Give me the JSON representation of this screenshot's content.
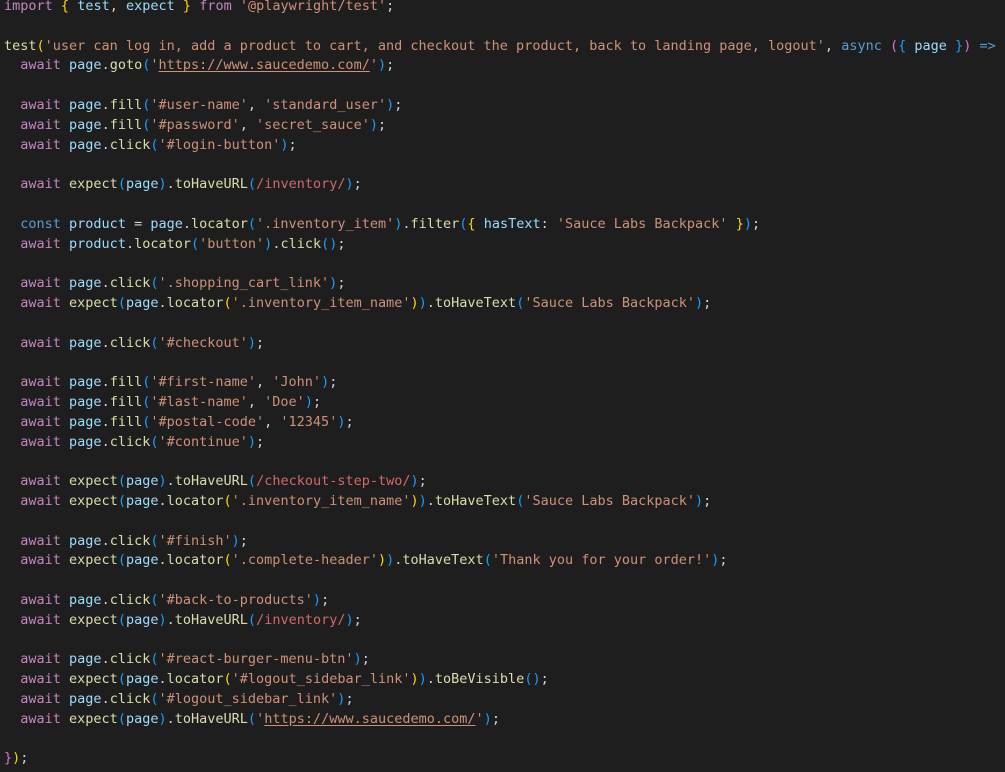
{
  "editor": {
    "lines": [
      [
        [
          "k",
          "import"
        ],
        [
          "p",
          " "
        ],
        [
          "b1",
          "{"
        ],
        [
          "p",
          " "
        ],
        [
          "v",
          "test"
        ],
        [
          "p",
          ", "
        ],
        [
          "v",
          "expect"
        ],
        [
          "p",
          " "
        ],
        [
          "b1",
          "}"
        ],
        [
          "p",
          " "
        ],
        [
          "k",
          "from"
        ],
        [
          "p",
          " "
        ],
        [
          "s",
          "'@playwright/test'"
        ],
        [
          "p",
          ";"
        ]
      ],
      [],
      [
        [
          "f",
          "test"
        ],
        [
          "b1",
          "("
        ],
        [
          "s",
          "'user can log in, add a product to cart, and checkout the product, back to landing page, logout'"
        ],
        [
          "p",
          ", "
        ],
        [
          "d",
          "async"
        ],
        [
          "p",
          " "
        ],
        [
          "b2",
          "("
        ],
        [
          "b3",
          "{"
        ],
        [
          "p",
          " "
        ],
        [
          "v",
          "page"
        ],
        [
          "p",
          " "
        ],
        [
          "b3",
          "}"
        ],
        [
          "b2",
          ")"
        ],
        [
          "p",
          " "
        ],
        [
          "d",
          "=>"
        ],
        [
          "p",
          " "
        ],
        [
          "b2",
          "{"
        ]
      ],
      [
        [
          "p",
          "  "
        ],
        [
          "k",
          "await"
        ],
        [
          "p",
          " "
        ],
        [
          "v",
          "page"
        ],
        [
          "p",
          "."
        ],
        [
          "f",
          "goto"
        ],
        [
          "b3",
          "("
        ],
        [
          "s",
          "'"
        ],
        [
          "us",
          "https://www.saucedemo.com/"
        ],
        [
          "s",
          "'"
        ],
        [
          "b3",
          ")"
        ],
        [
          "p",
          ";"
        ]
      ],
      [],
      [
        [
          "p",
          "  "
        ],
        [
          "k",
          "await"
        ],
        [
          "p",
          " "
        ],
        [
          "v",
          "page"
        ],
        [
          "p",
          "."
        ],
        [
          "f",
          "fill"
        ],
        [
          "b3",
          "("
        ],
        [
          "s",
          "'#user-name'"
        ],
        [
          "p",
          ", "
        ],
        [
          "s",
          "'standard_user'"
        ],
        [
          "b3",
          ")"
        ],
        [
          "p",
          ";"
        ]
      ],
      [
        [
          "p",
          "  "
        ],
        [
          "k",
          "await"
        ],
        [
          "p",
          " "
        ],
        [
          "v",
          "page"
        ],
        [
          "p",
          "."
        ],
        [
          "f",
          "fill"
        ],
        [
          "b3",
          "("
        ],
        [
          "s",
          "'#password'"
        ],
        [
          "p",
          ", "
        ],
        [
          "s",
          "'secret_sauce'"
        ],
        [
          "b3",
          ")"
        ],
        [
          "p",
          ";"
        ]
      ],
      [
        [
          "p",
          "  "
        ],
        [
          "k",
          "await"
        ],
        [
          "p",
          " "
        ],
        [
          "v",
          "page"
        ],
        [
          "p",
          "."
        ],
        [
          "f",
          "click"
        ],
        [
          "b3",
          "("
        ],
        [
          "s",
          "'#login-button'"
        ],
        [
          "b3",
          ")"
        ],
        [
          "p",
          ";"
        ]
      ],
      [],
      [
        [
          "p",
          "  "
        ],
        [
          "k",
          "await"
        ],
        [
          "p",
          " "
        ],
        [
          "f",
          "expect"
        ],
        [
          "b3",
          "("
        ],
        [
          "v",
          "page"
        ],
        [
          "b3",
          ")"
        ],
        [
          "p",
          "."
        ],
        [
          "f",
          "toHaveURL"
        ],
        [
          "b3",
          "("
        ],
        [
          "r",
          "/inventory/"
        ],
        [
          "b3",
          ")"
        ],
        [
          "p",
          ";"
        ]
      ],
      [],
      [
        [
          "p",
          "  "
        ],
        [
          "d",
          "const"
        ],
        [
          "p",
          " "
        ],
        [
          "v",
          "product"
        ],
        [
          "p",
          " = "
        ],
        [
          "v",
          "page"
        ],
        [
          "p",
          "."
        ],
        [
          "f",
          "locator"
        ],
        [
          "b3",
          "("
        ],
        [
          "s",
          "'.inventory_item'"
        ],
        [
          "b3",
          ")"
        ],
        [
          "p",
          "."
        ],
        [
          "f",
          "filter"
        ],
        [
          "b3",
          "("
        ],
        [
          "b1",
          "{"
        ],
        [
          "p",
          " "
        ],
        [
          "v",
          "hasText"
        ],
        [
          "p",
          ": "
        ],
        [
          "s",
          "'Sauce Labs Backpack'"
        ],
        [
          "p",
          " "
        ],
        [
          "b1",
          "}"
        ],
        [
          "b3",
          ")"
        ],
        [
          "p",
          ";"
        ]
      ],
      [
        [
          "p",
          "  "
        ],
        [
          "k",
          "await"
        ],
        [
          "p",
          " "
        ],
        [
          "v",
          "product"
        ],
        [
          "p",
          "."
        ],
        [
          "f",
          "locator"
        ],
        [
          "b3",
          "("
        ],
        [
          "s",
          "'button'"
        ],
        [
          "b3",
          ")"
        ],
        [
          "p",
          "."
        ],
        [
          "f",
          "click"
        ],
        [
          "b3",
          "("
        ],
        [
          "b3",
          ")"
        ],
        [
          "p",
          ";"
        ]
      ],
      [],
      [
        [
          "p",
          "  "
        ],
        [
          "k",
          "await"
        ],
        [
          "p",
          " "
        ],
        [
          "v",
          "page"
        ],
        [
          "p",
          "."
        ],
        [
          "f",
          "click"
        ],
        [
          "b3",
          "("
        ],
        [
          "s",
          "'.shopping_cart_link'"
        ],
        [
          "b3",
          ")"
        ],
        [
          "p",
          ";"
        ]
      ],
      [
        [
          "p",
          "  "
        ],
        [
          "k",
          "await"
        ],
        [
          "p",
          " "
        ],
        [
          "f",
          "expect"
        ],
        [
          "b3",
          "("
        ],
        [
          "v",
          "page"
        ],
        [
          "p",
          "."
        ],
        [
          "f",
          "locator"
        ],
        [
          "b1",
          "("
        ],
        [
          "s",
          "'.inventory_item_name'"
        ],
        [
          "b1",
          ")"
        ],
        [
          "b3",
          ")"
        ],
        [
          "p",
          "."
        ],
        [
          "f",
          "toHaveText"
        ],
        [
          "b3",
          "("
        ],
        [
          "s",
          "'Sauce Labs Backpack'"
        ],
        [
          "b3",
          ")"
        ],
        [
          "p",
          ";"
        ]
      ],
      [],
      [
        [
          "p",
          "  "
        ],
        [
          "k",
          "await"
        ],
        [
          "p",
          " "
        ],
        [
          "v",
          "page"
        ],
        [
          "p",
          "."
        ],
        [
          "f",
          "click"
        ],
        [
          "b3",
          "("
        ],
        [
          "s",
          "'#checkout'"
        ],
        [
          "b3",
          ")"
        ],
        [
          "p",
          ";"
        ]
      ],
      [],
      [
        [
          "p",
          "  "
        ],
        [
          "k",
          "await"
        ],
        [
          "p",
          " "
        ],
        [
          "v",
          "page"
        ],
        [
          "p",
          "."
        ],
        [
          "f",
          "fill"
        ],
        [
          "b3",
          "("
        ],
        [
          "s",
          "'#first-name'"
        ],
        [
          "p",
          ", "
        ],
        [
          "s",
          "'John'"
        ],
        [
          "b3",
          ")"
        ],
        [
          "p",
          ";"
        ]
      ],
      [
        [
          "p",
          "  "
        ],
        [
          "k",
          "await"
        ],
        [
          "p",
          " "
        ],
        [
          "v",
          "page"
        ],
        [
          "p",
          "."
        ],
        [
          "f",
          "fill"
        ],
        [
          "b3",
          "("
        ],
        [
          "s",
          "'#last-name'"
        ],
        [
          "p",
          ", "
        ],
        [
          "s",
          "'Doe'"
        ],
        [
          "b3",
          ")"
        ],
        [
          "p",
          ";"
        ]
      ],
      [
        [
          "p",
          "  "
        ],
        [
          "k",
          "await"
        ],
        [
          "p",
          " "
        ],
        [
          "v",
          "page"
        ],
        [
          "p",
          "."
        ],
        [
          "f",
          "fill"
        ],
        [
          "b3",
          "("
        ],
        [
          "s",
          "'#postal-code'"
        ],
        [
          "p",
          ", "
        ],
        [
          "s",
          "'12345'"
        ],
        [
          "b3",
          ")"
        ],
        [
          "p",
          ";"
        ]
      ],
      [
        [
          "p",
          "  "
        ],
        [
          "k",
          "await"
        ],
        [
          "p",
          " "
        ],
        [
          "v",
          "page"
        ],
        [
          "p",
          "."
        ],
        [
          "f",
          "click"
        ],
        [
          "b3",
          "("
        ],
        [
          "s",
          "'#continue'"
        ],
        [
          "b3",
          ")"
        ],
        [
          "p",
          ";"
        ]
      ],
      [],
      [
        [
          "p",
          "  "
        ],
        [
          "k",
          "await"
        ],
        [
          "p",
          " "
        ],
        [
          "f",
          "expect"
        ],
        [
          "b3",
          "("
        ],
        [
          "v",
          "page"
        ],
        [
          "b3",
          ")"
        ],
        [
          "p",
          "."
        ],
        [
          "f",
          "toHaveURL"
        ],
        [
          "b3",
          "("
        ],
        [
          "r",
          "/checkout-step-two/"
        ],
        [
          "b3",
          ")"
        ],
        [
          "p",
          ";"
        ]
      ],
      [
        [
          "p",
          "  "
        ],
        [
          "k",
          "await"
        ],
        [
          "p",
          " "
        ],
        [
          "f",
          "expect"
        ],
        [
          "b3",
          "("
        ],
        [
          "v",
          "page"
        ],
        [
          "p",
          "."
        ],
        [
          "f",
          "locator"
        ],
        [
          "b1",
          "("
        ],
        [
          "s",
          "'.inventory_item_name'"
        ],
        [
          "b1",
          ")"
        ],
        [
          "b3",
          ")"
        ],
        [
          "p",
          "."
        ],
        [
          "f",
          "toHaveText"
        ],
        [
          "b3",
          "("
        ],
        [
          "s",
          "'Sauce Labs Backpack'"
        ],
        [
          "b3",
          ")"
        ],
        [
          "p",
          ";"
        ]
      ],
      [],
      [
        [
          "p",
          "  "
        ],
        [
          "k",
          "await"
        ],
        [
          "p",
          " "
        ],
        [
          "v",
          "page"
        ],
        [
          "p",
          "."
        ],
        [
          "f",
          "click"
        ],
        [
          "b3",
          "("
        ],
        [
          "s",
          "'#finish'"
        ],
        [
          "b3",
          ")"
        ],
        [
          "p",
          ";"
        ]
      ],
      [
        [
          "p",
          "  "
        ],
        [
          "k",
          "await"
        ],
        [
          "p",
          " "
        ],
        [
          "f",
          "expect"
        ],
        [
          "b3",
          "("
        ],
        [
          "v",
          "page"
        ],
        [
          "p",
          "."
        ],
        [
          "f",
          "locator"
        ],
        [
          "b1",
          "("
        ],
        [
          "s",
          "'.complete-header'"
        ],
        [
          "b1",
          ")"
        ],
        [
          "b3",
          ")"
        ],
        [
          "p",
          "."
        ],
        [
          "f",
          "toHaveText"
        ],
        [
          "b3",
          "("
        ],
        [
          "s",
          "'Thank you for your order!'"
        ],
        [
          "b3",
          ")"
        ],
        [
          "p",
          ";"
        ]
      ],
      [],
      [
        [
          "p",
          "  "
        ],
        [
          "k",
          "await"
        ],
        [
          "p",
          " "
        ],
        [
          "v",
          "page"
        ],
        [
          "p",
          "."
        ],
        [
          "f",
          "click"
        ],
        [
          "b3",
          "("
        ],
        [
          "s",
          "'#back-to-products'"
        ],
        [
          "b3",
          ")"
        ],
        [
          "p",
          ";"
        ]
      ],
      [
        [
          "p",
          "  "
        ],
        [
          "k",
          "await"
        ],
        [
          "p",
          " "
        ],
        [
          "f",
          "expect"
        ],
        [
          "b3",
          "("
        ],
        [
          "v",
          "page"
        ],
        [
          "b3",
          ")"
        ],
        [
          "p",
          "."
        ],
        [
          "f",
          "toHaveURL"
        ],
        [
          "b3",
          "("
        ],
        [
          "r",
          "/inventory/"
        ],
        [
          "b3",
          ")"
        ],
        [
          "p",
          ";"
        ]
      ],
      [],
      [
        [
          "p",
          "  "
        ],
        [
          "k",
          "await"
        ],
        [
          "p",
          " "
        ],
        [
          "v",
          "page"
        ],
        [
          "p",
          "."
        ],
        [
          "f",
          "click"
        ],
        [
          "b3",
          "("
        ],
        [
          "s",
          "'#react-burger-menu-btn'"
        ],
        [
          "b3",
          ")"
        ],
        [
          "p",
          ";"
        ]
      ],
      [
        [
          "p",
          "  "
        ],
        [
          "k",
          "await"
        ],
        [
          "p",
          " "
        ],
        [
          "f",
          "expect"
        ],
        [
          "b3",
          "("
        ],
        [
          "v",
          "page"
        ],
        [
          "p",
          "."
        ],
        [
          "f",
          "locator"
        ],
        [
          "b1",
          "("
        ],
        [
          "s",
          "'#logout_sidebar_link'"
        ],
        [
          "b1",
          ")"
        ],
        [
          "b3",
          ")"
        ],
        [
          "p",
          "."
        ],
        [
          "f",
          "toBeVisible"
        ],
        [
          "b3",
          "("
        ],
        [
          "b3",
          ")"
        ],
        [
          "p",
          ";"
        ]
      ],
      [
        [
          "p",
          "  "
        ],
        [
          "k",
          "await"
        ],
        [
          "p",
          " "
        ],
        [
          "v",
          "page"
        ],
        [
          "p",
          "."
        ],
        [
          "f",
          "click"
        ],
        [
          "b3",
          "("
        ],
        [
          "s",
          "'#logout_sidebar_link'"
        ],
        [
          "b3",
          ")"
        ],
        [
          "p",
          ";"
        ]
      ],
      [
        [
          "p",
          "  "
        ],
        [
          "k",
          "await"
        ],
        [
          "p",
          " "
        ],
        [
          "f",
          "expect"
        ],
        [
          "b3",
          "("
        ],
        [
          "v",
          "page"
        ],
        [
          "b3",
          ")"
        ],
        [
          "p",
          "."
        ],
        [
          "f",
          "toHaveURL"
        ],
        [
          "b3",
          "("
        ],
        [
          "s",
          "'"
        ],
        [
          "us",
          "https://www.saucedemo.com/"
        ],
        [
          "s",
          "'"
        ],
        [
          "b3",
          ")"
        ],
        [
          "p",
          ";"
        ]
      ],
      [],
      [
        [
          "b2",
          "}"
        ],
        [
          "b1",
          ")"
        ],
        [
          "p",
          ";"
        ]
      ]
    ]
  },
  "colors": {
    "background": "#1e1e1e",
    "keyword": "#c586c0",
    "declaration": "#569cd6",
    "variable": "#9cdcfe",
    "function": "#dcdcaa",
    "string": "#ce9178",
    "regex": "#d16969",
    "punctuation": "#d4d4d4",
    "bracket_1": "#ffd700",
    "bracket_2": "#da70d6",
    "bracket_3": "#179fff"
  }
}
